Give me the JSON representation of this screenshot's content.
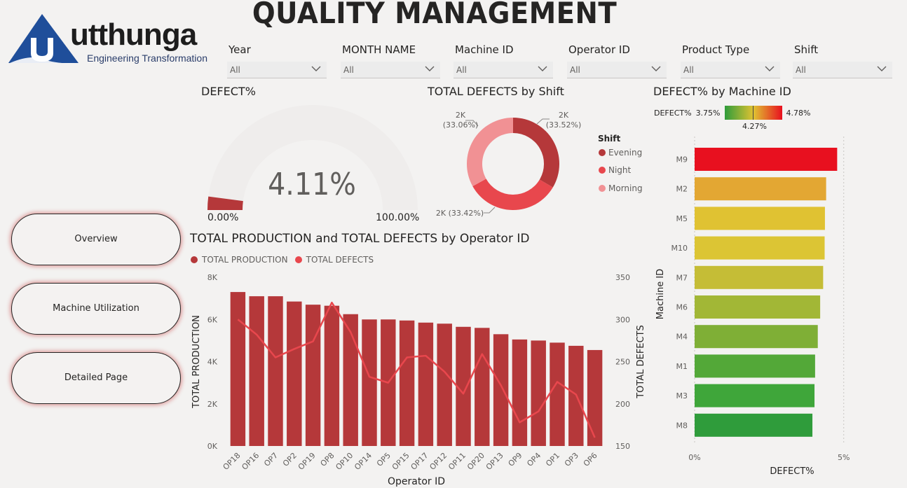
{
  "logo": {
    "wordmark": "utthunga",
    "tagline": "Engineering Transformation"
  },
  "page_title": "QUALITY MANAGEMENT",
  "slicers": [
    {
      "label": "Year",
      "value": "All"
    },
    {
      "label": "MONTH NAME",
      "value": "All"
    },
    {
      "label": "Machine ID",
      "value": "All"
    },
    {
      "label": "Operator ID",
      "value": "All"
    },
    {
      "label": "Product Type",
      "value": "All"
    },
    {
      "label": "Shift",
      "value": "All"
    }
  ],
  "nav": {
    "overview": "Overview",
    "machine_utilization": "Machine Utilization",
    "detailed": "Detailed Page"
  },
  "gauge": {
    "title": "DEFECT%",
    "value_label": "4.11%",
    "min_label": "0.00%",
    "max_label": "100.00%",
    "fill_fraction": 0.0411,
    "fill_color": "#b5383a",
    "track_color": "#efedec"
  },
  "donut": {
    "title": "TOTAL DEFECTS by Shift",
    "legend_title": "Shift",
    "labels": {
      "evening": [
        "2K",
        "(33.52%)"
      ],
      "night": [
        "2K (33.42%)"
      ],
      "morning": [
        "2K",
        "(33.06%)"
      ]
    }
  },
  "machine_chart": {
    "title": "DEFECT% by Machine ID",
    "scale": {
      "label": "DEFECT%",
      "min_label": "3.75%",
      "max_label": "4.78%",
      "mid_label": "4.27%"
    },
    "ylabel": "Machine ID",
    "xlabel": "DEFECT%",
    "tick_labels": [
      "0%",
      "5%"
    ]
  },
  "combo_chart": {
    "title": "TOTAL PRODUCTION and TOTAL DEFECTS by Operator ID",
    "legend": [
      "TOTAL PRODUCTION",
      "TOTAL DEFECTS"
    ],
    "ylabel_left": "TOTAL PRODUCTION",
    "ylabel_right": "TOTAL DEFECTS",
    "xlabel": "Operator ID"
  },
  "chart_data": [
    {
      "type": "pie",
      "title": "TOTAL DEFECTS by Shift",
      "categories": [
        "Evening",
        "Night",
        "Morning"
      ],
      "values": [
        33.52,
        33.42,
        33.06
      ],
      "colors": [
        "#b5383a",
        "#e8474d",
        "#f19194"
      ]
    },
    {
      "type": "bar",
      "title": "DEFECT% by Machine ID",
      "categories": [
        "M9",
        "M2",
        "M5",
        "M10",
        "M7",
        "M6",
        "M4",
        "M1",
        "M3",
        "M8"
      ],
      "values": [
        4.78,
        4.41,
        4.37,
        4.36,
        4.31,
        4.21,
        4.13,
        4.04,
        4.02,
        3.95
      ],
      "colors": [
        "#e8101f",
        "#e3a733",
        "#e0c232",
        "#dcc534",
        "#c5bd36",
        "#a2b736",
        "#7faf36",
        "#53a838",
        "#3fa63a",
        "#2f9c3b"
      ],
      "xlim": [
        0,
        5.5
      ],
      "orientation": "horizontal"
    },
    {
      "type": "bar",
      "title": "TOTAL PRODUCTION and TOTAL DEFECTS by Operator ID",
      "categories": [
        "OP18",
        "OP16",
        "OP7",
        "OP2",
        "OP19",
        "OP8",
        "OP10",
        "OP14",
        "OP5",
        "OP15",
        "OP17",
        "OP12",
        "OP11",
        "OP20",
        "OP13",
        "OP9",
        "OP4",
        "OP1",
        "OP3",
        "OP6"
      ],
      "series": [
        {
          "name": "TOTAL PRODUCTION",
          "values": [
            7300,
            7100,
            7100,
            6850,
            6700,
            6650,
            6250,
            6000,
            6000,
            5950,
            5850,
            5800,
            5650,
            5600,
            5300,
            5050,
            5000,
            4900,
            4750,
            4550
          ],
          "axis": "left",
          "color": "#b5383a"
        },
        {
          "name": "TOTAL DEFECTS",
          "values": [
            300,
            282,
            255,
            265,
            274,
            320,
            285,
            232,
            225,
            255,
            257,
            238,
            212,
            259,
            222,
            178,
            191,
            226,
            211,
            160
          ],
          "axis": "right",
          "color": "#e8474d"
        }
      ],
      "ylim_left": [
        0,
        8000
      ],
      "ylim_right": [
        150,
        350
      ],
      "yticks_left": [
        "0K",
        "2K",
        "4K",
        "6K",
        "8K"
      ],
      "yticks_right": [
        "150",
        "200",
        "250",
        "300",
        "350"
      ]
    }
  ]
}
